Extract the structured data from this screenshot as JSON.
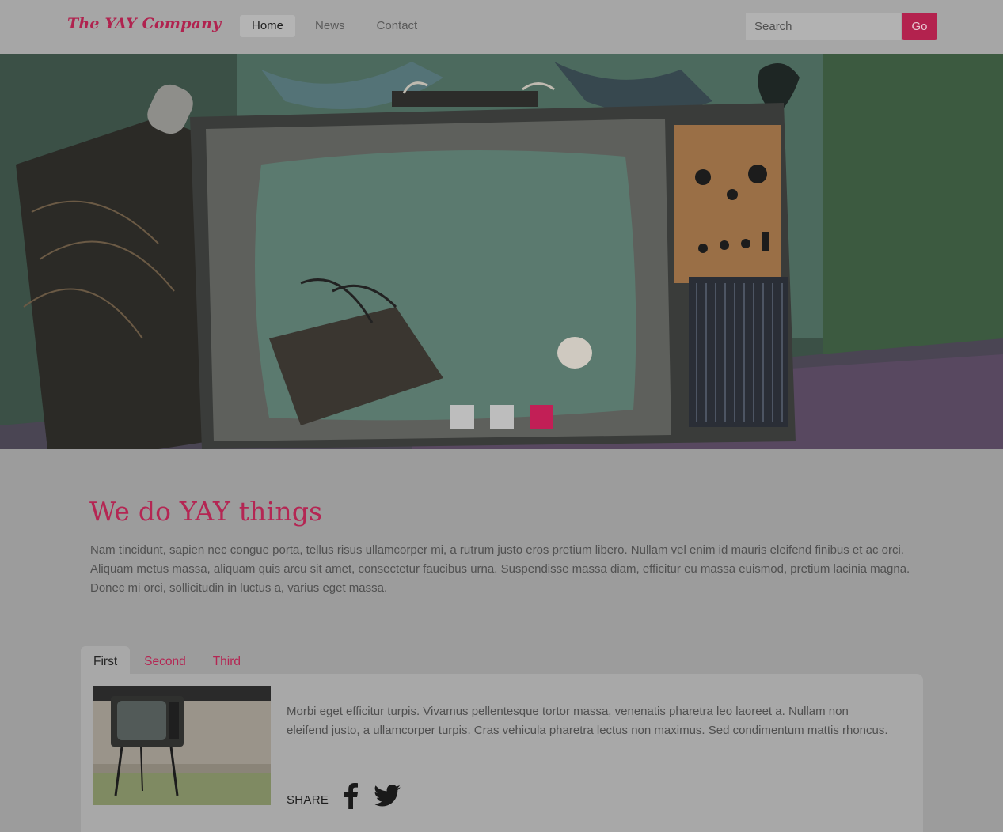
{
  "header": {
    "brand": "The YAY Company",
    "nav": [
      "Home",
      "News",
      "Contact"
    ],
    "active_nav": "Home",
    "search_placeholder": "Search",
    "go_label": "Go"
  },
  "hero": {
    "slides_count": 3,
    "active_slide": 3
  },
  "intro": {
    "title": "We do YAY things",
    "text": "Nam tincidunt, sapien nec congue porta, tellus risus ullamcorper mi, a rutrum justo eros pretium libero. Nullam vel enim id mauris eleifend finibus et ac orci. Aliquam metus massa, aliquam quis arcu sit amet, consectetur faucibus urna. Suspendisse massa diam, efficitur eu massa euismod, pretium lacinia magna. Donec mi orci, sollicitudin in luctus a, varius eget massa."
  },
  "tabs": {
    "labels": [
      "First",
      "Second",
      "Third"
    ],
    "active": "First",
    "panel_text": "Morbi eget efficitur turpis. Vivamus pellentesque tortor massa, venenatis pharetra leo laoreet a. Nullam non eleifend justo, a ullamcorper turpis. Cras vehicula pharetra lectus non maximus. Sed condimentum mattis rhoncus.",
    "share_label": "SHARE"
  },
  "icons": {
    "facebook": "facebook-icon",
    "twitter": "twitter-icon"
  },
  "colors": {
    "accent": "#c21f56",
    "overlay_bg": "#9c9c9c"
  }
}
